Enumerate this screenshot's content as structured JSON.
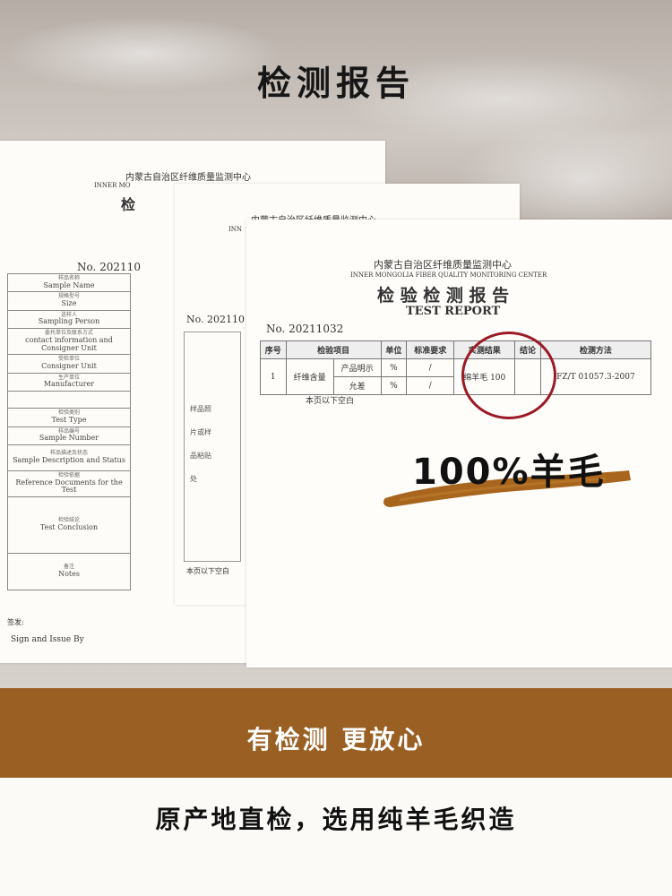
{
  "page": {
    "title": "检测报告"
  },
  "doc1": {
    "org_cn": "内蒙古自治区纤维质量监测中心",
    "org_en": "INNER MO",
    "title_cn": "检",
    "report_no": "No. 202110",
    "fields": [
      {
        "cn": "样品名称",
        "en": "Sample Name"
      },
      {
        "cn": "规格型号",
        "en": "Size"
      },
      {
        "cn": "送样人",
        "en": "Sampling Person"
      },
      {
        "cn": "委托单位及联系方式",
        "en": "contact information and Consigner Unit"
      },
      {
        "cn": "受检单位",
        "en": "Consigner Unit"
      },
      {
        "cn": "生产单位",
        "en": "Manufacturer"
      },
      {
        "cn": "",
        "en": ""
      },
      {
        "cn": "检验类别",
        "en": "Test Type"
      },
      {
        "cn": "样品编号",
        "en": "Sample Number"
      },
      {
        "cn": "样品描述及状态",
        "en": "Sample Description and Status"
      },
      {
        "cn": "检验依据",
        "en": "Reference Documents for the Test"
      },
      {
        "cn": "检验结论",
        "en": "Test Conclusion"
      },
      {
        "cn": "备注",
        "en": "Notes"
      }
    ],
    "sign_cn": "签发:",
    "sign_en": "Sign and Issue By"
  },
  "doc2": {
    "org_cn": "内蒙古自治区纤维质量监测中心",
    "org_en": "INN",
    "report_no": "No. 202110",
    "photo_lines": [
      "样品照",
      "片或样",
      "品粘贴",
      "处"
    ],
    "blank_note": "本页以下空白"
  },
  "doc3": {
    "org_cn": "内蒙古自治区纤维质量监测中心",
    "org_en": "INNER MONGOLIA FIBER QUALITY MONITORING CENTER",
    "title_cn": "检 验 检 测 报 告",
    "title_en": "TEST REPORT",
    "report_no": "No. 20211032",
    "headers": [
      "序号",
      "检验项目",
      "单位",
      "标准要求",
      "实测结果",
      "结论",
      "检测方法"
    ],
    "row": {
      "index": "1",
      "item": "纤维含量",
      "sub1": "产品明示",
      "sub2": "允差",
      "unit1": "%",
      "unit2": "%",
      "std1": "/",
      "std2": "/",
      "result": "绵羊毛 100",
      "method": "FZ/T 01057.3-2007"
    },
    "blank_note": "本页以下空白"
  },
  "callout": "100%羊毛",
  "band_text": "有检测 更放心",
  "footer_text": "原产地直检，选用纯羊毛织造",
  "colors": {
    "band": "#9a5f23",
    "circle": "#9b1a26",
    "brush": "#a8651d"
  }
}
